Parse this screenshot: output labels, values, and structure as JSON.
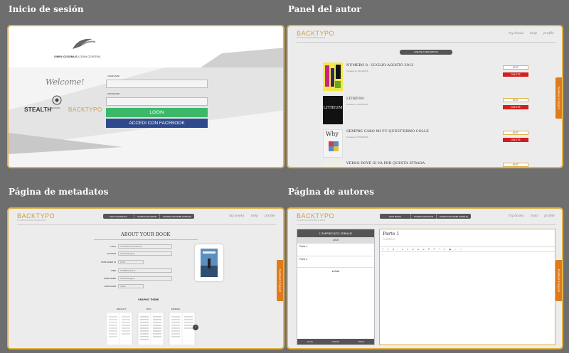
{
  "panels": {
    "login": {
      "title": "Inicio de sesión"
    },
    "author": {
      "title": "Panel del autor"
    },
    "metadata": {
      "title": "Página de metadatos"
    },
    "authors": {
      "title": "Página de autores"
    }
  },
  "login": {
    "brand": "SIMPLICISSIMUS",
    "brand_sub": "LOGIN CENTRAL",
    "welcome": "Welcome!",
    "stealth": "STEALTH",
    "narcissus": "NARCISSUS",
    "backtypo": "BACKTYPO",
    "username_label": "USERNAME",
    "password_label": "PASSWORD",
    "login_button": "LOGIN",
    "facebook_button": "ACCEDI CON FACEBOOK"
  },
  "header": {
    "logo": "BACKTYPO",
    "logo_sub": "BY SIMPLICISSIMUS BOOK FARM",
    "nav": [
      "my books",
      "help",
      "profile"
    ],
    "feedback": "Feedback & Support"
  },
  "author_panel": {
    "create_button": "CREATE A NEW EBOOK",
    "edit_label": "EDIT",
    "delete_label": "DELETE",
    "books": [
      {
        "title": "NUMERO 8 - LUGLIO-AGOSTO 2013",
        "date": "Created on 30/11/2015"
      },
      {
        "title": "LITHIUM",
        "date": "Created on 04/07/2015"
      },
      {
        "title": "SEMPRE CARO MI FU QUEST'ERMO COLLE",
        "date": "Created on 07/06/2015"
      },
      {
        "title": "VERSO DOVE SI VA PER QUESTA STRADA",
        "date": ""
      }
    ],
    "cover_texts": [
      "",
      "LITHIUM",
      "Why",
      ""
    ]
  },
  "metadata_page": {
    "tabs": [
      "EDIT CONTENTS",
      "DOWNLOAD EPUB",
      "DOWNLOAD MOBI (KINDLE)"
    ],
    "heading": "ABOUT YOUR BOOK",
    "fields": [
      {
        "label": "TITLE",
        "value": "L'IMPIEGATO IDEALE"
      },
      {
        "label": "AUTHOR",
        "value": "Natalia Bogdan"
      },
      {
        "label": "PUBLISHED IN",
        "value": "2015"
      },
      {
        "label": "ISBN",
        "value": "9788869230171"
      },
      {
        "label": "PUBLISHER",
        "value": "Natalia Bogdan"
      },
      {
        "label": "LANGUAGE",
        "value": "Italian"
      }
    ],
    "graphic_theme": "GRAPHIC THEME",
    "themes": [
      "DEFAULT",
      "DOC",
      "MINIMAL"
    ]
  },
  "authors_page": {
    "tabs": [
      "EDIT MODE",
      "DOWNLOAD EPUB",
      "DOWNLOAD MOBI (KINDLE)"
    ],
    "book_title": "L'IMPIEGATO IDEALE",
    "year": "2015",
    "chapters": [
      "Parte 1",
      "Parte 2"
    ],
    "add_label": "Add",
    "bottom_buttons": [
      "Home",
      "Chapter",
      "Delete"
    ],
    "editor_title": "Parte 1",
    "editor_subtitle": "Subtitle"
  }
}
